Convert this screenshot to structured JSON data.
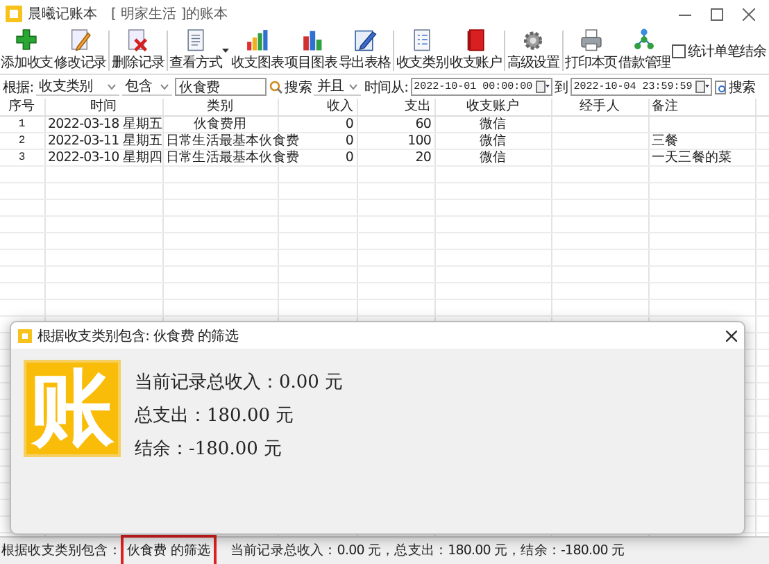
{
  "window": {
    "app_name": "晨曦记账本",
    "book": "[ 明家生活 ]的账本"
  },
  "toolbar": {
    "buttons": [
      {
        "label": "添加收支",
        "kind": "add",
        "menu": false,
        "separator_after": false
      },
      {
        "label": "修改记录",
        "kind": "edit",
        "menu": false,
        "separator_after": true
      },
      {
        "label": "删除记录",
        "kind": "delete",
        "menu": false,
        "separator_after": true
      },
      {
        "label": "查看方式",
        "kind": "view",
        "menu": true,
        "separator_after": false
      },
      {
        "label": "收支图表",
        "kind": "chart",
        "menu": false,
        "separator_after": false
      },
      {
        "label": "项目图表",
        "kind": "project",
        "menu": false,
        "separator_after": false
      },
      {
        "label": "导出表格",
        "kind": "export",
        "menu": false,
        "separator_after": true
      },
      {
        "label": "收支类别",
        "kind": "category",
        "menu": false,
        "separator_after": false
      },
      {
        "label": "收支账户",
        "kind": "account",
        "menu": false,
        "separator_after": true
      },
      {
        "label": "高级设置",
        "kind": "settings",
        "menu": false,
        "separator_after": true
      },
      {
        "label": "打印本页",
        "kind": "print",
        "menu": false,
        "separator_after": false
      },
      {
        "label": "借款管理",
        "kind": "loan",
        "menu": false,
        "separator_after": false
      }
    ],
    "checkbox": {
      "label": "统计单笔结余",
      "checked": false
    }
  },
  "filter": {
    "label": "根据:",
    "field": "收支类别",
    "match": "包含",
    "keyword": "伙食费",
    "search": "搜索",
    "logic": "并且",
    "from_label": "时间从:",
    "from": "2022-10-01 00:00:00",
    "to_label": "到",
    "to": "2022-10-04 23:59:59",
    "search_time": "搜索"
  },
  "table": {
    "columns": [
      "序号",
      "时间",
      "类别",
      "收入",
      "支出",
      "收支账户",
      "经手人",
      "备注"
    ],
    "rows": [
      [
        "1",
        "2022-03-18 星期五",
        "伙食费用",
        "0",
        "60",
        "微信",
        "",
        ""
      ],
      [
        "2",
        "2022-03-11 星期五",
        "日常生活最基本伙食费",
        "0",
        "100",
        "微信",
        "",
        "三餐"
      ],
      [
        "3",
        "2022-03-10 星期四",
        "日常生活最基本伙食费",
        "0",
        "20",
        "微信",
        "",
        "一天三餐的菜"
      ]
    ]
  },
  "dialog": {
    "title": "根据收支类别包含: 伙食费 的筛选",
    "logo": "账",
    "lines": [
      "当前记录总收入：0.00 元",
      "总支出：180.00 元",
      "结余：-180.00 元"
    ]
  },
  "status_bar": {
    "filter_prefix": "根据收支类别包含：",
    "filter_value": "伙食费 的筛选",
    "highlighted": true,
    "summary": "当前记录总收入：0.00 元，总支出：180.00 元，结余：-180.00 元"
  }
}
